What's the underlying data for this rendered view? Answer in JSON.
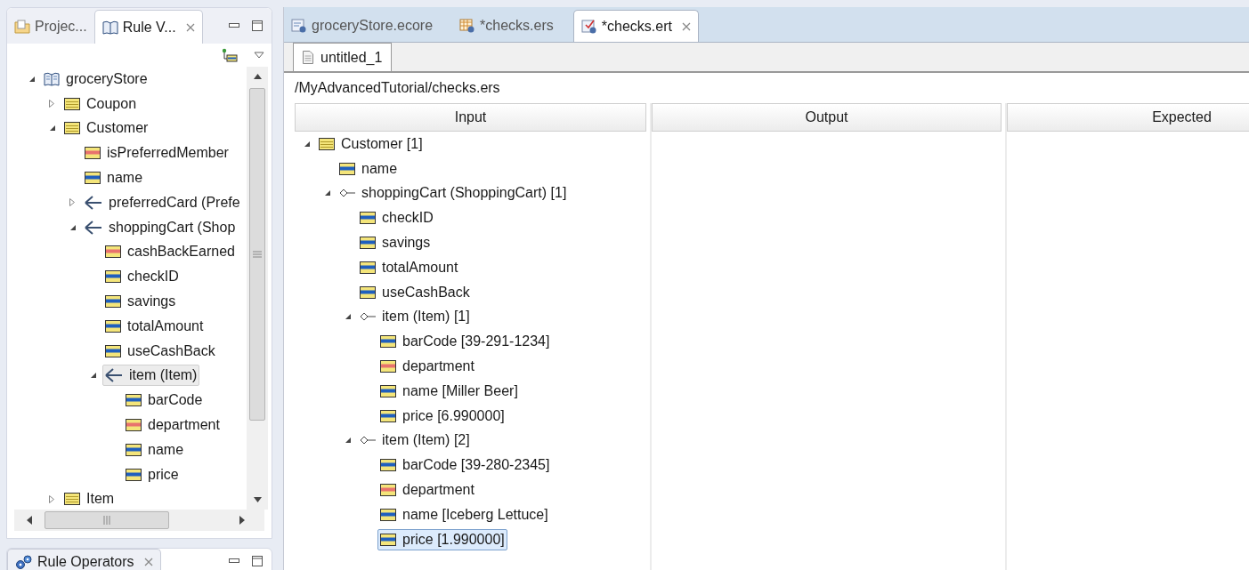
{
  "left_panel": {
    "tabs": [
      {
        "label": "Projec...",
        "kind": "project",
        "selected": false
      },
      {
        "label": "Rule V...",
        "kind": "rules",
        "selected": true
      }
    ],
    "tree": [
      {
        "label": "groceryStore",
        "kind": "package",
        "expanded": true,
        "selected": false,
        "children": [
          {
            "label": "Coupon",
            "kind": "class",
            "expanded": false,
            "selected": false
          },
          {
            "label": "Customer",
            "kind": "class",
            "expanded": true,
            "selected": false,
            "children": [
              {
                "label": "isPreferredMember",
                "kind": "attribute",
                "color": "#e8726e",
                "selected": false
              },
              {
                "label": "name",
                "kind": "attribute",
                "color": "#1f5fbf",
                "selected": false
              },
              {
                "label": "preferredCard (Prefe",
                "kind": "reference",
                "expanded": false,
                "selected": false
              },
              {
                "label": "shoppingCart (Shop",
                "kind": "reference",
                "expanded": true,
                "selected": false,
                "children": [
                  {
                    "label": "cashBackEarned",
                    "kind": "attribute",
                    "color": "#e8726e",
                    "selected": false
                  },
                  {
                    "label": "checkID",
                    "kind": "attribute",
                    "color": "#1f5fbf",
                    "selected": false
                  },
                  {
                    "label": "savings",
                    "kind": "attribute",
                    "color": "#1f5fbf",
                    "selected": false
                  },
                  {
                    "label": "totalAmount",
                    "kind": "attribute",
                    "color": "#1f5fbf",
                    "selected": false
                  },
                  {
                    "label": "useCashBack",
                    "kind": "attribute",
                    "color": "#1f5fbf",
                    "selected": false
                  },
                  {
                    "label": "item (Item)",
                    "kind": "reference",
                    "expanded": true,
                    "selected": true,
                    "children": [
                      {
                        "label": "barCode",
                        "kind": "attribute",
                        "color": "#1f5fbf",
                        "selected": false
                      },
                      {
                        "label": "department",
                        "kind": "attribute",
                        "color": "#e8726e",
                        "selected": false
                      },
                      {
                        "label": "name",
                        "kind": "attribute",
                        "color": "#1f5fbf",
                        "selected": false
                      },
                      {
                        "label": "price",
                        "kind": "attribute",
                        "color": "#1f5fbf",
                        "selected": false
                      }
                    ]
                  }
                ]
              }
            ]
          },
          {
            "label": "Item",
            "kind": "class",
            "expanded": false,
            "selected": false
          }
        ]
      }
    ]
  },
  "bottom_panel": {
    "tabs": [
      {
        "label": "Rule Operators",
        "kind": "operators",
        "selected": true
      }
    ]
  },
  "editor": {
    "tabs": [
      {
        "label": "groceryStore.ecore",
        "kind": "ecore",
        "selected": false
      },
      {
        "label": "*checks.ers",
        "kind": "ers",
        "selected": false
      },
      {
        "label": "*checks.ert",
        "kind": "ert",
        "selected": true
      }
    ],
    "page_tabs": [
      {
        "label": "untitled_1",
        "selected": true
      }
    ],
    "path": "/MyAdvancedTutorial/checks.ers",
    "table": {
      "columns": [
        "Input",
        "Output",
        "Expected"
      ],
      "tree": [
        {
          "label": "Customer [1]",
          "kind": "class",
          "expanded": true,
          "selected": false,
          "children": [
            {
              "label": "name",
              "kind": "attribute",
              "color": "#1f5fbf",
              "selected": false
            },
            {
              "label": "shoppingCart (ShoppingCart) [1]",
              "kind": "containment",
              "expanded": true,
              "selected": false,
              "children": [
                {
                  "label": "checkID",
                  "kind": "attribute",
                  "color": "#1f5fbf",
                  "selected": false
                },
                {
                  "label": "savings",
                  "kind": "attribute",
                  "color": "#1f5fbf",
                  "selected": false
                },
                {
                  "label": "totalAmount",
                  "kind": "attribute",
                  "color": "#1f5fbf",
                  "selected": false
                },
                {
                  "label": "useCashBack",
                  "kind": "attribute",
                  "color": "#1f5fbf",
                  "selected": false
                },
                {
                  "label": "item (Item) [1]",
                  "kind": "containment",
                  "expanded": true,
                  "selected": false,
                  "children": [
                    {
                      "label": "barCode [39-291-1234]",
                      "kind": "attribute",
                      "color": "#1f5fbf",
                      "selected": false
                    },
                    {
                      "label": "department",
                      "kind": "attribute",
                      "color": "#e8726e",
                      "selected": false
                    },
                    {
                      "label": "name [Miller Beer]",
                      "kind": "attribute",
                      "color": "#1f5fbf",
                      "selected": false
                    },
                    {
                      "label": "price [6.990000]",
                      "kind": "attribute",
                      "color": "#1f5fbf",
                      "selected": false
                    }
                  ]
                },
                {
                  "label": "item (Item) [2]",
                  "kind": "containment",
                  "expanded": true,
                  "selected": false,
                  "children": [
                    {
                      "label": "barCode [39-280-2345]",
                      "kind": "attribute",
                      "color": "#1f5fbf",
                      "selected": false
                    },
                    {
                      "label": "department",
                      "kind": "attribute",
                      "color": "#e8726e",
                      "selected": false
                    },
                    {
                      "label": "name [Iceberg Lettuce]",
                      "kind": "attribute",
                      "color": "#1f5fbf",
                      "selected": false
                    },
                    {
                      "label": "price [1.990000]",
                      "kind": "attribute",
                      "color": "#1f5fbf",
                      "selected": true
                    }
                  ]
                }
              ]
            }
          ]
        }
      ]
    }
  }
}
